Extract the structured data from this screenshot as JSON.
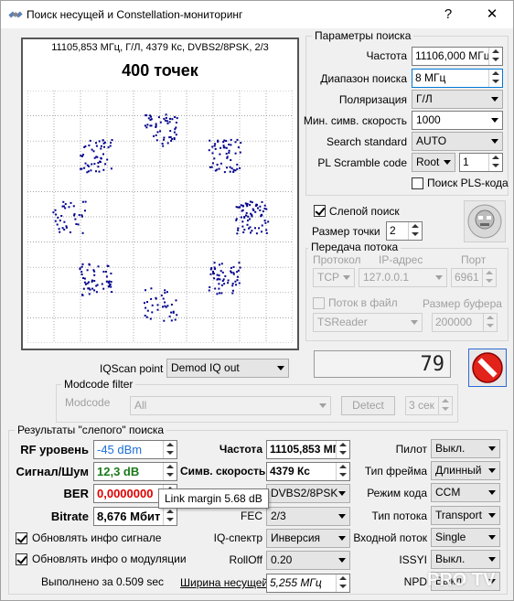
{
  "window": {
    "title": "Поиск несущей и Constellation-мониторинг",
    "help_label": "?",
    "close_label": "✕"
  },
  "plot": {
    "header": "11105,853 МГц, Г/Л, 4379 Кс, DVBS2/8PSK, 2/3",
    "points_label": "400 точек"
  },
  "search_params": {
    "title": "Параметры поиска",
    "freq_label": "Частота",
    "freq_value": "11106,000 МГц",
    "range_label": "Диапазон поиска",
    "range_value": "8 МГц",
    "pol_label": "Поляризация",
    "pol_value": "Г/Л",
    "min_sr_label": "Мин. симв. скорость",
    "min_sr_value": "1000",
    "standard_label": "Search standard",
    "standard_value": "AUTO",
    "pls_label": "PL Scramble code",
    "pls_mode": "Root",
    "pls_value": "1",
    "pls_search_label": "Поиск PLS-кода",
    "blind_label": "Слепой поиск",
    "point_size_label": "Размер точки",
    "point_size_value": "2"
  },
  "stream": {
    "title": "Передача потока",
    "protocol_label": "Протокол",
    "ip_label": "IP-адрес",
    "port_label": "Порт",
    "protocol_value": "TCP",
    "ip_value": "127.0.0.1",
    "port_value": "6961",
    "to_file_label": "Поток в файл",
    "buffer_label": "Размер буфера",
    "writer_value": "TSReader",
    "buffer_value": "200000"
  },
  "counter": {
    "value": "79"
  },
  "iqscan": {
    "label": "IQScan point",
    "value": "Demod IQ out"
  },
  "modcode": {
    "title": "Modcode filter",
    "label": "Modcode",
    "value": "All",
    "detect_label": "Detect",
    "timeout_value": "3 сек"
  },
  "results": {
    "title": "Результаты \"слепого\" поиска",
    "rf_label": "RF уровень",
    "rf_value": "-45 dBm",
    "snr_label": "Сигнал/Шум",
    "snr_value": "12,3 dB",
    "ber_label": "BER",
    "ber_value": "0,0000000",
    "bitrate_label": "Bitrate",
    "bitrate_value": "8,676 Мбит",
    "freq_label": "Частота",
    "freq_value": "11105,853 МГц",
    "sr_label": "Симв. скорость",
    "sr_value": "4379 Кс",
    "mod_value": "DVBS2/8PSK",
    "fec_label": "FEC",
    "fec_value": "2/3",
    "iq_label": "IQ-спектр",
    "iq_value": "Инверсия",
    "rolloff_label": "RollOff",
    "rolloff_value": "0.20",
    "bw_label": "Ширина несущей",
    "bw_value": "5,255 МГц",
    "pilot_label": "Пилот",
    "pilot_value": "Выкл.",
    "frame_label": "Тип фрейма",
    "frame_value": "Длинный",
    "ccm_label": "Режим кода",
    "ccm_value": "CCM",
    "stream_type_label": "Тип потока",
    "stream_type_value": "Transport",
    "input_stream_label": "Входной поток",
    "input_stream_value": "Single",
    "issyi_label": "ISSYI",
    "issyi_value": "Выкл.",
    "npd_label": "NPD",
    "npd_value": "Выкл.",
    "update_signal_label": "Обновлять инфо сигнале",
    "update_mod_label": "Обновлять инфо о модуляции",
    "done_label": "Выполнено за 0.509 sec"
  },
  "tooltip": {
    "text": "Link margin 5.68 dB"
  },
  "watermark": {
    "text": "PRO TV"
  },
  "colors": {
    "rf": "#1f6fd8",
    "snr": "#1a7a1a",
    "ber": "#e00000",
    "dots": "#00008b"
  }
}
